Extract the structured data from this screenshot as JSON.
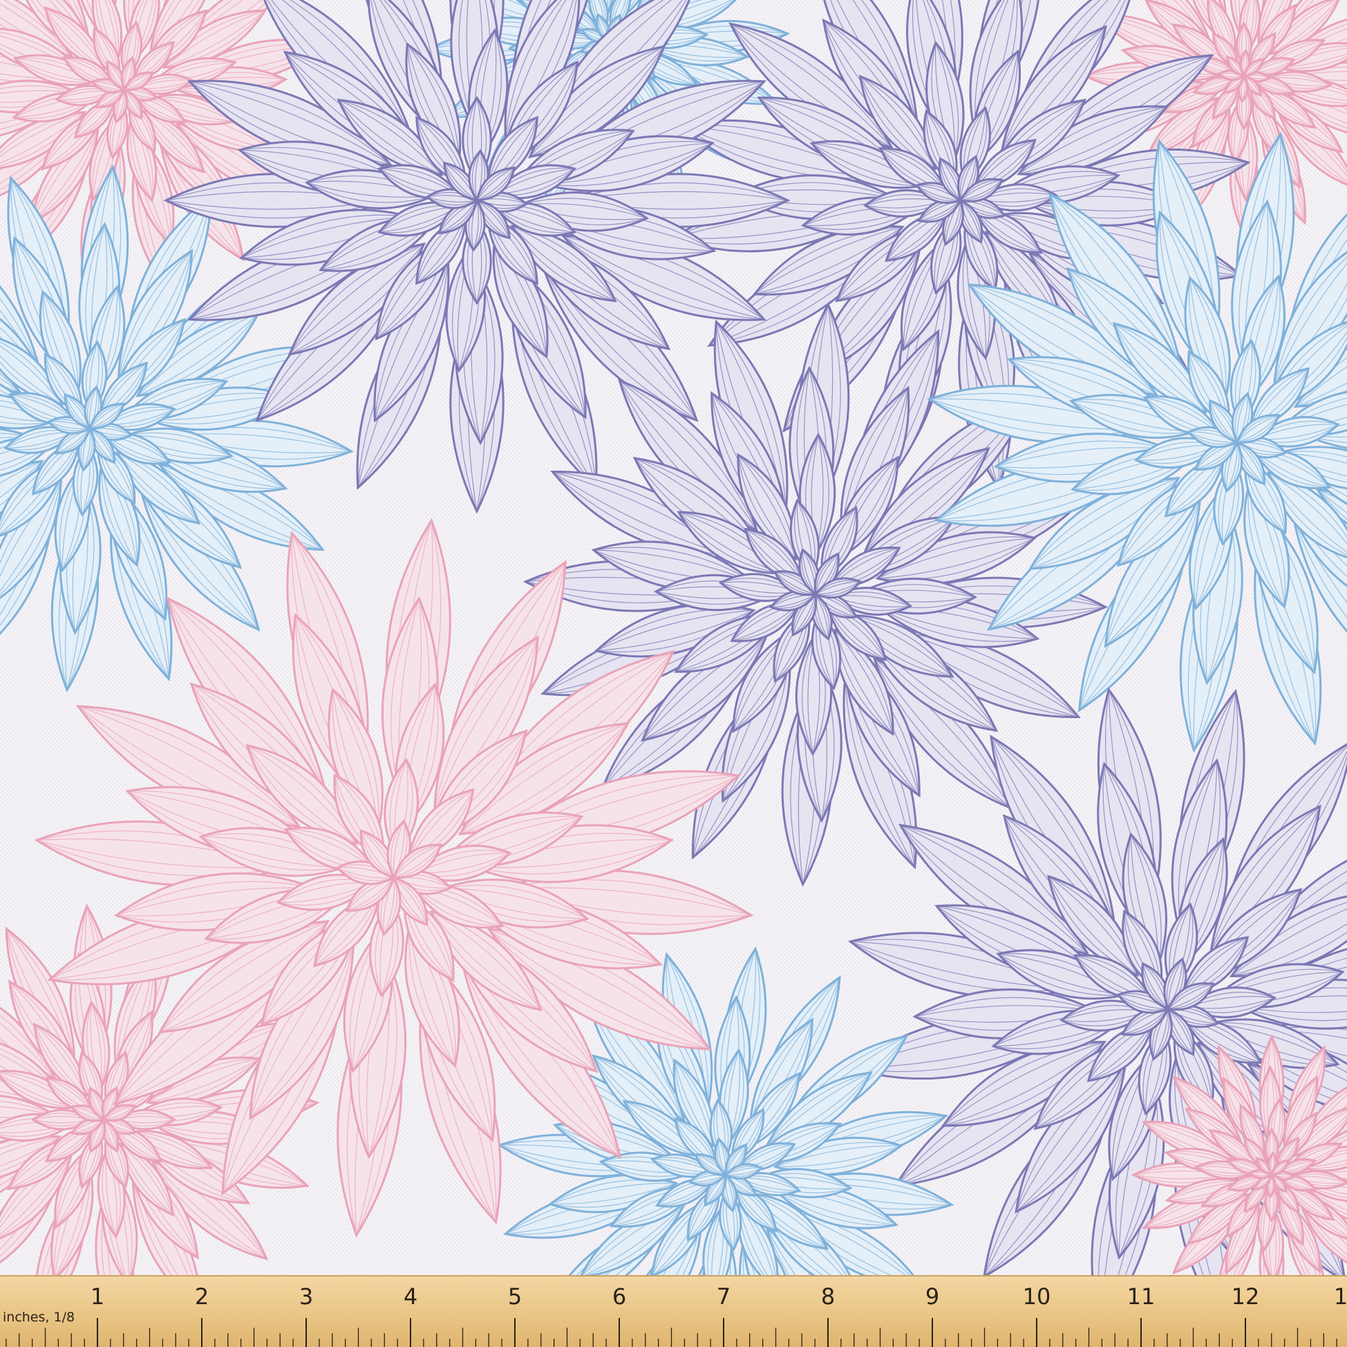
{
  "product": {
    "description": "floral fabric swatch with dahlia line-art pattern",
    "colors": {
      "background": "#f3f1f5",
      "pink": "#e9a3b8",
      "blue": "#7fb1da",
      "purple": "#7c78b4"
    }
  },
  "ruler": {
    "unit_label": "inches, 1/8",
    "numbers": [
      "1",
      "2",
      "3",
      "4",
      "5",
      "6",
      "7",
      "8",
      "9",
      "10",
      "11",
      "12",
      "1"
    ],
    "color": "#e9c584"
  }
}
